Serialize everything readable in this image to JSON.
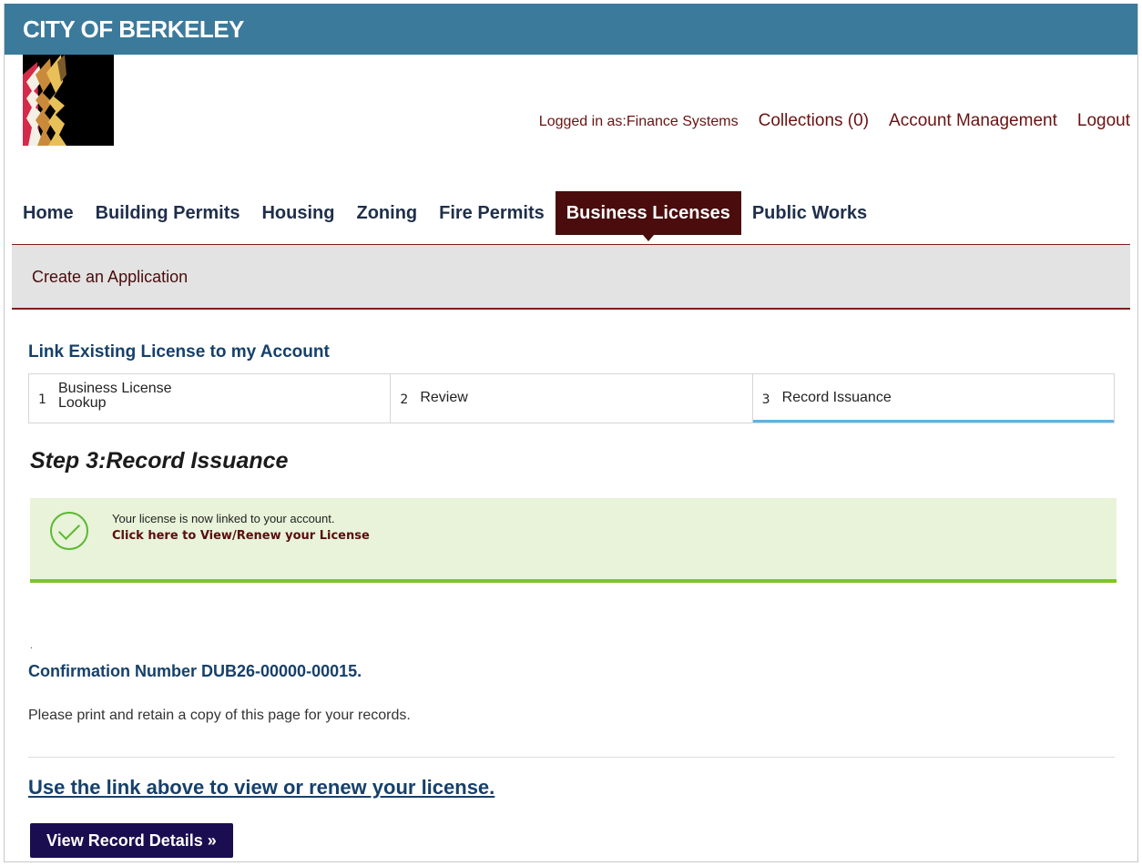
{
  "banner": {
    "title": "CITY OF BERKELEY"
  },
  "topnav": {
    "logged_in": "Logged in as:Finance Systems",
    "collections": "Collections (0)",
    "account_management": "Account Management",
    "logout": "Logout"
  },
  "tabs": [
    {
      "label": "Home"
    },
    {
      "label": "Building Permits"
    },
    {
      "label": "Housing"
    },
    {
      "label": "Zoning"
    },
    {
      "label": "Fire Permits"
    },
    {
      "label": "Business Licenses",
      "active": true
    },
    {
      "label": "Public Works"
    }
  ],
  "subbar": {
    "title": "Create an Application"
  },
  "section": {
    "title": "Link Existing License to my Account"
  },
  "steps": [
    {
      "num": "1",
      "label": "Business License Lookup"
    },
    {
      "num": "2",
      "label": "Review"
    },
    {
      "num": "3",
      "label": "Record Issuance",
      "current": true
    }
  ],
  "step_heading": "Step 3:Record Issuance",
  "notice": {
    "message": "Your license is now linked to your account.",
    "link": "Click here to View/Renew your License",
    "icon": "checkmark-circle-icon"
  },
  "dot": ".",
  "confirmation": "Confirmation Number DUB26-00000-00015.",
  "retain_text": "Please print and retain a copy of this page for your records.",
  "use_link": "Use the link above to view or renew your license.",
  "button": {
    "label": "View Record Details »"
  },
  "colors": {
    "banner": "#3b7a9b",
    "active_tab": "#4a0c0c",
    "link_dark_red": "#6a1212",
    "heading_blue": "#16406b",
    "success_bg": "#e8f3d9",
    "success_border": "#7ec529",
    "step_active_underline": "#5ab4e6",
    "button_bg": "#1a0d50"
  }
}
